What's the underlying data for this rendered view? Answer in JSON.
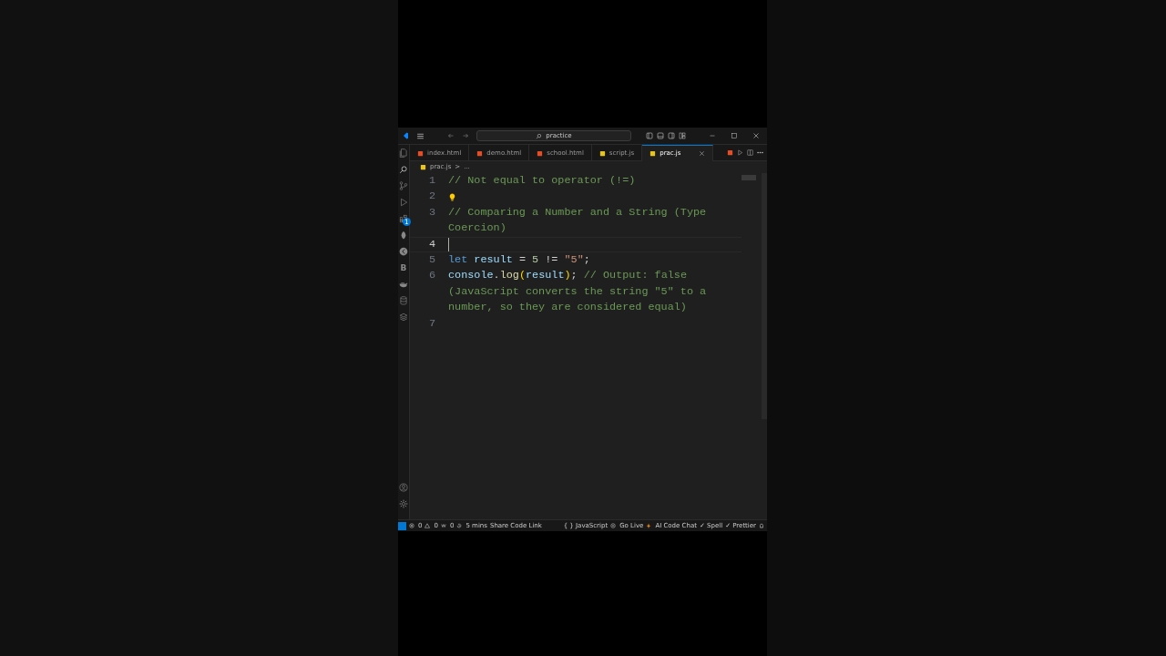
{
  "title_bar": {
    "search": "practice"
  },
  "activity_bar": {
    "top": [
      {
        "kind": "files"
      },
      {
        "kind": "search"
      },
      {
        "kind": "source-control"
      },
      {
        "kind": "run"
      },
      {
        "kind": "extensions",
        "badge": "1"
      },
      {
        "kind": "leaf"
      },
      {
        "kind": "circle"
      },
      {
        "kind": "letter",
        "text": "B"
      },
      {
        "kind": "whale"
      },
      {
        "kind": "database"
      },
      {
        "kind": "layers"
      }
    ],
    "bottom": [
      {
        "kind": "account"
      },
      {
        "kind": "settings"
      }
    ]
  },
  "tabs": [
    {
      "label": "index.html",
      "kind": "html",
      "selected": false
    },
    {
      "label": "demo.html",
      "kind": "html",
      "selected": false
    },
    {
      "label": "school.html",
      "kind": "html",
      "selected": false
    },
    {
      "label": "script.js",
      "kind": "js",
      "selected": false
    },
    {
      "label": "prac.js",
      "kind": "js",
      "selected": true
    }
  ],
  "breadcrumb": {
    "file": "prac.js",
    "separator": ">",
    "more": "..."
  },
  "editor": {
    "lines": [
      {
        "number": "1",
        "current": false,
        "tokens": [
          {
            "kind": "comment",
            "text": "// Not equal to operator (!=)"
          }
        ]
      },
      {
        "number": "2",
        "current": false,
        "lightbulb": true
      },
      {
        "number": "3",
        "current": false,
        "tokens": [
          {
            "kind": "comment",
            "text": "// Comparing a Number and a String (Type Coercion)"
          }
        ]
      },
      {
        "number": "4",
        "current": true
      },
      {
        "number": "5",
        "current": false,
        "tokens": [
          {
            "kind": "keyword",
            "text": "let"
          },
          {
            "kind": "variable",
            "text": " result"
          },
          {
            "kind": "plain",
            "text": " = "
          },
          {
            "kind": "number",
            "text": "5"
          },
          {
            "kind": "plain",
            "text": " != "
          },
          {
            "kind": "string",
            "text": "\"5\""
          },
          {
            "kind": "plain",
            "text": ";"
          }
        ]
      },
      {
        "number": "6",
        "current": false,
        "tokens": [
          {
            "kind": "variable",
            "text": "console"
          },
          {
            "kind": "plain",
            "text": "."
          },
          {
            "kind": "function",
            "text": "log"
          },
          {
            "kind": "bracket",
            "text": "("
          },
          {
            "kind": "variable",
            "text": "result"
          },
          {
            "kind": "bracket",
            "text": ")"
          },
          {
            "kind": "plain",
            "text": "; "
          },
          {
            "kind": "comment",
            "text": "// Output: false (JavaScript converts the string \"5\" to a number, so they are considered equal)"
          }
        ]
      },
      {
        "number": "7",
        "current": false
      }
    ]
  },
  "status_bar": [
    {
      "kind": "remote"
    },
    {
      "kind": "error",
      "text": "0"
    },
    {
      "kind": "warning",
      "text": "0"
    },
    {
      "kind": "ports",
      "text": "0"
    },
    {
      "kind": "history",
      "text": "5 mins"
    },
    {
      "kind": "plain",
      "text": "Share Code Link"
    },
    {
      "kind": "gap"
    },
    {
      "kind": "plain",
      "text": "{ } JavaScript"
    },
    {
      "kind": "broadcast",
      "text": "Go Live"
    },
    {
      "kind": "spark",
      "text": "AI Code Chat"
    },
    {
      "kind": "plain",
      "text": "✓ Spell"
    },
    {
      "kind": "plain",
      "text": "✓ Prettier"
    },
    {
      "kind": "bell"
    }
  ]
}
